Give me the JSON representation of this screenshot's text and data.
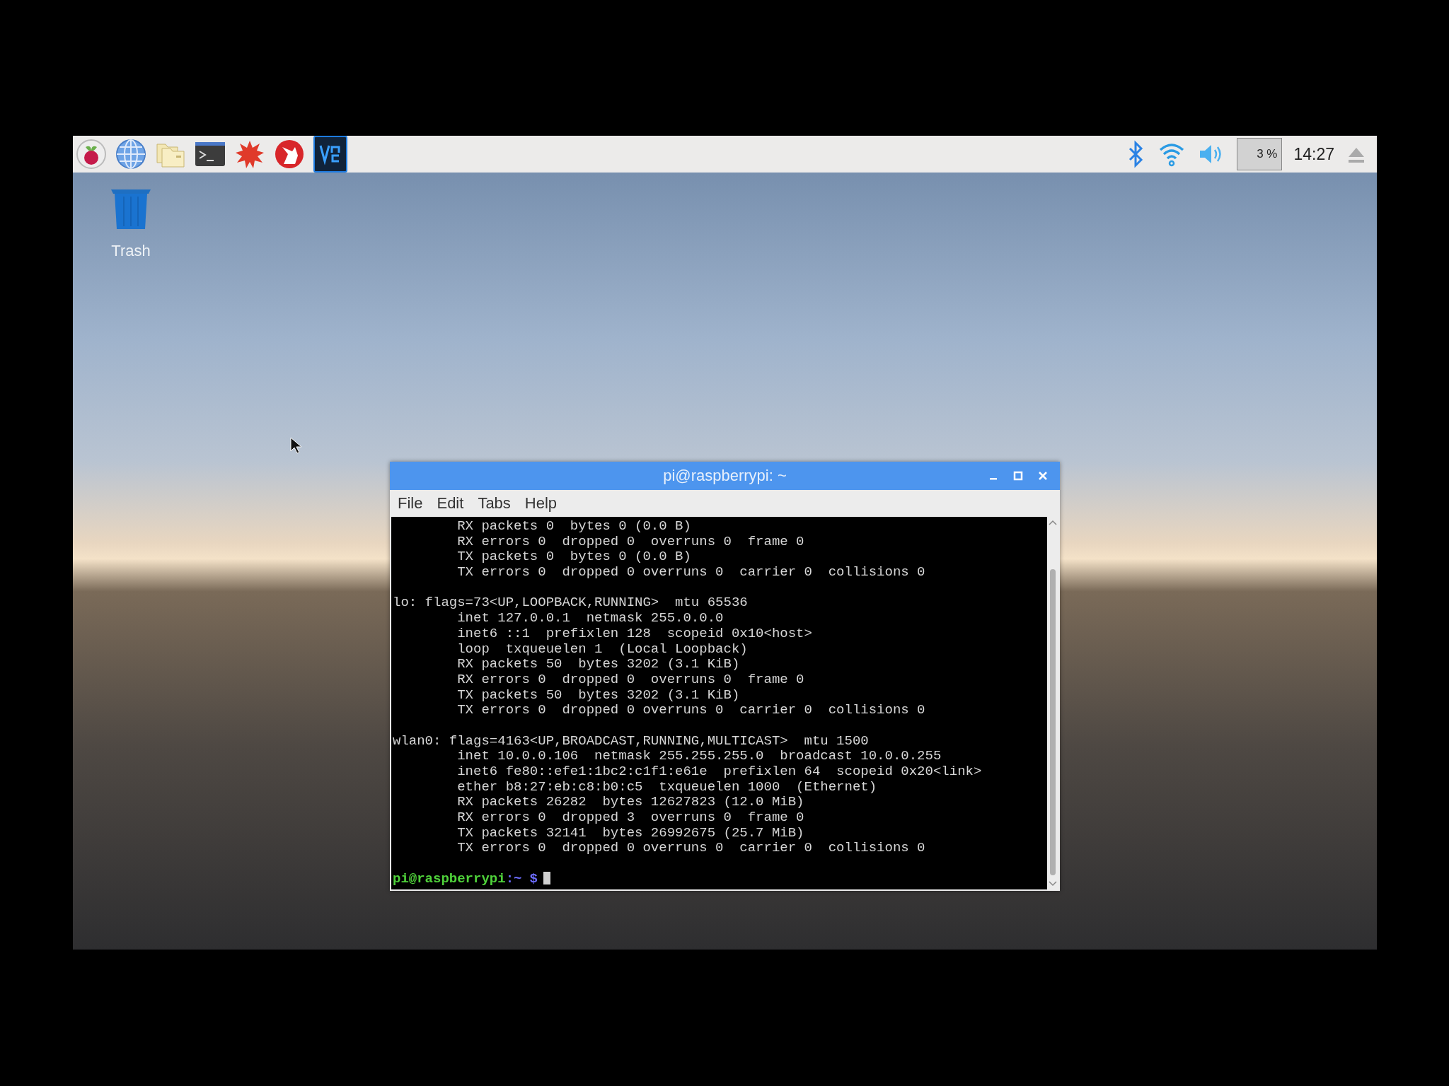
{
  "taskbar": {
    "cpu_usage": "3 %",
    "clock": "14:27"
  },
  "desktop": {
    "icons": [
      {
        "label": "Trash"
      }
    ]
  },
  "terminal": {
    "title": "pi@raspberrypi: ~",
    "menu": [
      "File",
      "Edit",
      "Tabs",
      "Help"
    ],
    "lines": [
      {
        "kind": "output",
        "text": "        RX packets 0  bytes 0 (0.0 B)"
      },
      {
        "kind": "output",
        "text": "        RX errors 0  dropped 0  overruns 0  frame 0"
      },
      {
        "kind": "output",
        "text": "        TX packets 0  bytes 0 (0.0 B)"
      },
      {
        "kind": "output",
        "text": "        TX errors 0  dropped 0 overruns 0  carrier 0  collisions 0"
      },
      {
        "kind": "blank"
      },
      {
        "kind": "output",
        "text": "lo: flags=73<UP,LOOPBACK,RUNNING>  mtu 65536"
      },
      {
        "kind": "output",
        "text": "        inet 127.0.0.1  netmask 255.0.0.0"
      },
      {
        "kind": "output",
        "text": "        inet6 ::1  prefixlen 128  scopeid 0x10<host>"
      },
      {
        "kind": "output",
        "text": "        loop  txqueuelen 1  (Local Loopback)"
      },
      {
        "kind": "output",
        "text": "        RX packets 50  bytes 3202 (3.1 KiB)"
      },
      {
        "kind": "output",
        "text": "        RX errors 0  dropped 0  overruns 0  frame 0"
      },
      {
        "kind": "output",
        "text": "        TX packets 50  bytes 3202 (3.1 KiB)"
      },
      {
        "kind": "output",
        "text": "        TX errors 0  dropped 0 overruns 0  carrier 0  collisions 0"
      },
      {
        "kind": "blank"
      },
      {
        "kind": "output",
        "text": "wlan0: flags=4163<UP,BROADCAST,RUNNING,MULTICAST>  mtu 1500"
      },
      {
        "kind": "output",
        "text": "        inet 10.0.0.106  netmask 255.255.255.0  broadcast 10.0.0.255"
      },
      {
        "kind": "output",
        "text": "        inet6 fe80::efe1:1bc2:c1f1:e61e  prefixlen 64  scopeid 0x20<link>"
      },
      {
        "kind": "output",
        "text": "        ether b8:27:eb:c8:b0:c5  txqueuelen 1000  (Ethernet)"
      },
      {
        "kind": "output",
        "text": "        RX packets 26282  bytes 12627823 (12.0 MiB)"
      },
      {
        "kind": "output",
        "text": "        RX errors 0  dropped 3  overruns 0  frame 0"
      },
      {
        "kind": "output",
        "text": "        TX packets 32141  bytes 26992675 (25.7 MiB)"
      },
      {
        "kind": "output",
        "text": "        TX errors 0  dropped 0 overruns 0  carrier 0  collisions 0"
      },
      {
        "kind": "blank"
      },
      {
        "kind": "prompt",
        "user_host": "pi@raspberrypi",
        "path": ":~",
        "symbol": "$"
      }
    ]
  }
}
